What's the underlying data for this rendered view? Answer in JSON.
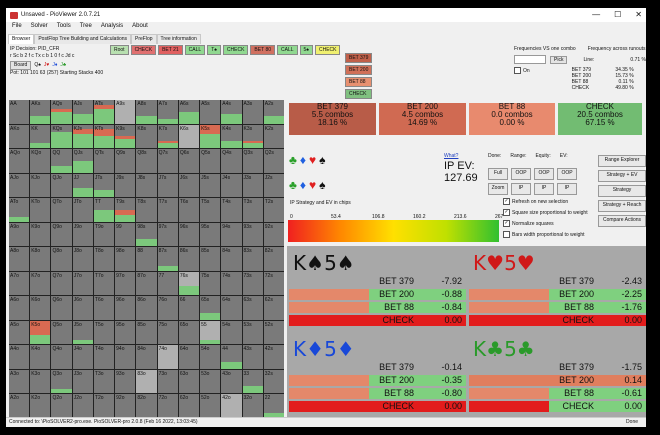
{
  "window": {
    "title": "Unsaved - PioViewer 2.0.7.21",
    "controls": {
      "minimize": "—",
      "maximize": "☐",
      "close": "✕"
    }
  },
  "menu": [
    "File",
    "Solver",
    "Tools",
    "Tree",
    "Analysis",
    "About"
  ],
  "tabs": [
    "Browser",
    "PostFlop Tree Building and Calculations",
    "PreFlop",
    "Tree information"
  ],
  "info": {
    "decision": "IP Decision:  PID_CFR",
    "board_text": "r Sc b 2 f c Tx c b 1 0 f c Jd c",
    "board_button": "Board",
    "suits": [
      "Q♠",
      "J♥",
      "J♦",
      "J♣"
    ],
    "pot": "Pot: 101 101 63 (257) Starting Stacks 400"
  },
  "action_row": [
    {
      "label": "Root",
      "color": "#b8e0b0"
    },
    {
      "label": "CHECK",
      "color": "#e07070"
    },
    {
      "label": "BET 21",
      "color": "#e06060"
    },
    {
      "label": "CALL",
      "color": "#90d890"
    },
    {
      "label": "T♠",
      "color": "#90d890"
    },
    {
      "label": "CHECK",
      "color": "#90d890"
    },
    {
      "label": "BET 80",
      "color": "#d07060"
    },
    {
      "label": "CALL",
      "color": "#90d890"
    },
    {
      "label": "5♠",
      "color": "#90d890"
    },
    {
      "label": "CHECK",
      "color": "#f0f070"
    }
  ],
  "action_col": [
    {
      "label": "BET 379",
      "color": "#c0604a"
    },
    {
      "label": "BET 200",
      "color": "#d07058"
    },
    {
      "label": "BET 88",
      "color": "#e89070"
    },
    {
      "label": "CHECK",
      "color": "#80c080"
    }
  ],
  "right_top": {
    "freq_title": "Frequencies VS one combo",
    "pick": "Pick",
    "on": "On",
    "runout_title": "Frequency across runouts",
    "line_label": "Line:",
    "line_value": "0.71 %",
    "runouts": [
      {
        "name": "BET 379",
        "value": "34.35 %"
      },
      {
        "name": "BET 200",
        "value": "15.73 %"
      },
      {
        "name": "BET 88",
        "value": "0.11 %"
      },
      {
        "name": "CHECK",
        "value": "49.80 %"
      }
    ]
  },
  "action_cards": [
    {
      "name": "BET 379",
      "combos": "5.5 combos",
      "pct": "18.16 %",
      "color": "#b85c48"
    },
    {
      "name": "BET 200",
      "combos": "4.5 combos",
      "pct": "14.69 %",
      "color": "#d06a52"
    },
    {
      "name": "BET 88",
      "combos": "0.0 combos",
      "pct": "0.00 %",
      "color": "#e88a6e"
    },
    {
      "name": "CHECK",
      "combos": "20.5 combos",
      "pct": "67.15 %",
      "color": "#72bc72"
    }
  ],
  "ev": {
    "what_link": "What?",
    "label": "IP EV:",
    "value": "127.69"
  },
  "mode_headers": [
    "Done:",
    "Range:",
    "Equity:",
    "EV:"
  ],
  "mode_buttons": [
    [
      "Full",
      "OOP",
      "OOP",
      "OOP"
    ],
    [
      "Zoom",
      "IP",
      "IP",
      "IP"
    ]
  ],
  "right_buttons": [
    "Range Explorer",
    "Strategy + EV",
    "Strategy",
    "Strategy + Reach",
    "Compare Actions"
  ],
  "strategy_label": "IP Strategy and EV in chips",
  "scale": [
    "0",
    "53.4",
    "106.8",
    "160.2",
    "213.6",
    "267"
  ],
  "checkboxes": [
    {
      "label": "Refresh on new selection",
      "checked": "✓"
    },
    {
      "label": "Square size proportional to weight",
      "checked": "✓"
    },
    {
      "label": "Normalize squares",
      "checked": "✓"
    },
    {
      "label": "Bars width proportional to weight",
      "checked": ""
    }
  ],
  "suit_icons": [
    {
      "glyph": "♣",
      "color": "#2aa02a"
    },
    {
      "glyph": "♦",
      "color": "#2060e0"
    },
    {
      "glyph": "♥",
      "color": "#e02020"
    },
    {
      "glyph": "♠",
      "color": "#111111"
    }
  ],
  "combos": [
    {
      "head_rank": "K",
      "head_suit1": "♠",
      "head_rank2": "5",
      "head_suit2": "♠",
      "color": "#111111",
      "rows": [
        {
          "name": "BET 379",
          "value": "-7.92",
          "fill": 0.0,
          "color": "#d97a5e"
        },
        {
          "name": "BET 200",
          "value": "-0.88",
          "fill": 0.45,
          "color": "#e08060"
        },
        {
          "name": "BET 88",
          "value": "-0.84",
          "fill": 0.45,
          "color": "#e48c6a"
        },
        {
          "name": "CHECK",
          "value": "0.00",
          "fill": 1.0,
          "color": "#e21c1c"
        }
      ]
    },
    {
      "head_rank": "K",
      "head_suit1": "♥",
      "head_rank2": "5",
      "head_suit2": "♥",
      "color": "#d01818",
      "rows": [
        {
          "name": "BET 379",
          "value": "-2.43",
          "fill": 0.0,
          "color": "#d97a5e"
        },
        {
          "name": "BET 200",
          "value": "-2.25",
          "fill": 0.45,
          "color": "#e08060"
        },
        {
          "name": "BET 88",
          "value": "-1.76",
          "fill": 0.45,
          "color": "#e48c6a"
        },
        {
          "name": "CHECK",
          "value": "0.00",
          "fill": 1.0,
          "color": "#e21c1c"
        }
      ]
    },
    {
      "head_rank": "K",
      "head_suit1": "♦",
      "head_rank2": "5",
      "head_suit2": "♦",
      "color": "#1848d8",
      "rows": [
        {
          "name": "BET 379",
          "value": "-0.14",
          "fill": 0.0,
          "color": "#d97a5e"
        },
        {
          "name": "BET 200",
          "value": "-0.35",
          "fill": 0.45,
          "color": "#e08060"
        },
        {
          "name": "BET 88",
          "value": "-0.80",
          "fill": 0.45,
          "color": "#e48c6a"
        },
        {
          "name": "CHECK",
          "value": "0.00",
          "fill": 1.0,
          "color": "#e21c1c"
        }
      ]
    },
    {
      "head_rank": "K",
      "head_suit1": "♣",
      "head_rank2": "5",
      "head_suit2": "♣",
      "color": "#2a9a2a",
      "rows": [
        {
          "name": "BET 379",
          "value": "-1.75",
          "fill": 0.0,
          "color": "#d97a5e"
        },
        {
          "name": "BET 200",
          "value": "0.14",
          "fill": 1.0,
          "color": "#e08060"
        },
        {
          "name": "BET 88",
          "value": "-0.61",
          "fill": 0.45,
          "color": "#e48c6a"
        },
        {
          "name": "CHECK",
          "value": "0.00",
          "fill": 0.45,
          "color": "#e21c1c"
        }
      ]
    }
  ],
  "matrix": {
    "labels": [
      [
        "AA",
        "AKs",
        "AQs",
        "AJs",
        "ATs",
        "A9s",
        "A8s",
        "A7s",
        "A6s",
        "A5s",
        "A4s",
        "A3s",
        "A2s"
      ],
      [
        "AKo",
        "KK",
        "KQs",
        "KJs",
        "KTs",
        "K9s",
        "K8s",
        "K7s",
        "K6s",
        "K5s",
        "K4s",
        "K3s",
        "K2s"
      ],
      [
        "AQo",
        "KQo",
        "QQ",
        "QJs",
        "QTs",
        "Q9s",
        "Q8s",
        "Q7s",
        "Q6s",
        "Q5s",
        "Q4s",
        "Q3s",
        "Q2s"
      ],
      [
        "AJo",
        "KJo",
        "QJo",
        "JJ",
        "JTs",
        "J9s",
        "J8s",
        "J7s",
        "J6s",
        "J5s",
        "J4s",
        "J3s",
        "J2s"
      ],
      [
        "ATo",
        "KTo",
        "QTo",
        "JTo",
        "TT",
        "T9s",
        "T8s",
        "T7s",
        "T6s",
        "T5s",
        "T4s",
        "T3s",
        "T2s"
      ],
      [
        "A9o",
        "K9o",
        "Q9o",
        "J9o",
        "T9o",
        "99",
        "98s",
        "97s",
        "96s",
        "95s",
        "94s",
        "93s",
        "92s"
      ],
      [
        "A8o",
        "K8o",
        "Q8o",
        "J8o",
        "T8o",
        "98o",
        "88",
        "87s",
        "86s",
        "85s",
        "84s",
        "83s",
        "82s"
      ],
      [
        "A7o",
        "K7o",
        "Q7o",
        "J7o",
        "T7o",
        "97o",
        "87o",
        "77",
        "76s",
        "75s",
        "74s",
        "73s",
        "72s"
      ],
      [
        "A6o",
        "K6o",
        "Q6o",
        "J6o",
        "T6o",
        "96o",
        "86o",
        "76o",
        "66",
        "65s",
        "64s",
        "63s",
        "62s"
      ],
      [
        "A5o",
        "K5o",
        "Q5o",
        "J5o",
        "T5o",
        "95o",
        "85o",
        "75o",
        "65o",
        "55",
        "54s",
        "53s",
        "52s"
      ],
      [
        "A4o",
        "K4o",
        "Q4o",
        "J4o",
        "T4o",
        "94o",
        "84o",
        "74o",
        "64o",
        "54o",
        "44",
        "43s",
        "42s"
      ],
      [
        "A3o",
        "K3o",
        "Q3o",
        "J3o",
        "T3o",
        "93o",
        "83o",
        "73o",
        "63o",
        "53o",
        "43o",
        "33",
        "32s"
      ],
      [
        "A2o",
        "K2o",
        "Q2o",
        "J2o",
        "T2o",
        "92o",
        "82o",
        "72o",
        "62o",
        "52o",
        "42o",
        "32o",
        "22"
      ]
    ],
    "highlights": [
      {
        "r": 0,
        "c": 1,
        "green": 0.3,
        "red": 0.0
      },
      {
        "r": 0,
        "c": 2,
        "green": 0.5,
        "red": 0.1
      },
      {
        "r": 0,
        "c": 3,
        "green": 0.4,
        "red": 0.0
      },
      {
        "r": 0,
        "c": 4,
        "green": 0.6,
        "red": 0.2
      },
      {
        "r": 0,
        "c": 6,
        "green": 0.3,
        "red": 0.0
      },
      {
        "r": 0,
        "c": 7,
        "green": 0.2,
        "red": 0.0
      },
      {
        "r": 0,
        "c": 8,
        "green": 0.5,
        "red": 0.0
      },
      {
        "r": 0,
        "c": 10,
        "green": 0.4,
        "red": 0.0
      },
      {
        "r": 0,
        "c": 12,
        "green": 0.3,
        "red": 0.0
      },
      {
        "r": 1,
        "c": 1,
        "green": 0.2,
        "red": 0.0
      },
      {
        "r": 1,
        "c": 2,
        "green": 0.7,
        "red": 0.0
      },
      {
        "r": 1,
        "c": 3,
        "green": 0.6,
        "red": 0.2
      },
      {
        "r": 1,
        "c": 4,
        "green": 0.5,
        "red": 0.3
      },
      {
        "r": 1,
        "c": 5,
        "green": 0.4,
        "red": 0.1
      },
      {
        "r": 1,
        "c": 7,
        "green": 0.2,
        "red": 0.1
      },
      {
        "r": 1,
        "c": 9,
        "green": 0.6,
        "red": 0.4
      },
      {
        "r": 1,
        "c": 10,
        "green": 0.3,
        "red": 0.0
      },
      {
        "r": 1,
        "c": 11,
        "green": 0.2,
        "red": 0.1
      },
      {
        "r": 2,
        "c": 2,
        "green": 0.3,
        "red": 0.0
      },
      {
        "r": 2,
        "c": 3,
        "green": 0.5,
        "red": 0.0
      },
      {
        "r": 3,
        "c": 3,
        "green": 0.4,
        "red": 0.0
      },
      {
        "r": 3,
        "c": 4,
        "green": 0.3,
        "red": 0.0
      },
      {
        "r": 4,
        "c": 0,
        "green": 0.2,
        "red": 0.0
      },
      {
        "r": 4,
        "c": 4,
        "green": 0.5,
        "red": 0.0
      },
      {
        "r": 4,
        "c": 5,
        "green": 0.3,
        "red": 0.2
      },
      {
        "r": 5,
        "c": 6,
        "green": 0.3,
        "red": 0.0
      },
      {
        "r": 6,
        "c": 7,
        "green": 0.2,
        "red": 0.0
      },
      {
        "r": 7,
        "c": 8,
        "green": 0.4,
        "red": 0.0
      },
      {
        "r": 8,
        "c": 9,
        "green": 0.3,
        "red": 0.0
      },
      {
        "r": 9,
        "c": 1,
        "green": 0.4,
        "red": 0.6
      },
      {
        "r": 9,
        "c": 3,
        "green": 0.2,
        "red": 0.0
      },
      {
        "r": 9,
        "c": 9,
        "green": 0.2,
        "red": 0.0
      },
      {
        "r": 10,
        "c": 10,
        "green": 0.3,
        "red": 0.0
      },
      {
        "r": 11,
        "c": 2,
        "green": 0.2,
        "red": 0.0
      },
      {
        "r": 11,
        "c": 11,
        "green": 0.3,
        "red": 0.0
      },
      {
        "r": 12,
        "c": 12,
        "green": 0.2,
        "red": 0.0
      }
    ],
    "light_cells": [
      [
        0,
        5
      ],
      [
        1,
        8
      ],
      [
        7,
        8
      ],
      [
        9,
        9
      ],
      [
        10,
        7
      ],
      [
        11,
        6
      ],
      [
        12,
        10
      ]
    ]
  },
  "status": {
    "left": "Connected to: \\PioSOLVER2-pro.exe. PioSOLVER-pro 2.0.8 (Feb 16 2022, 13:03:45)",
    "right": "Done"
  }
}
